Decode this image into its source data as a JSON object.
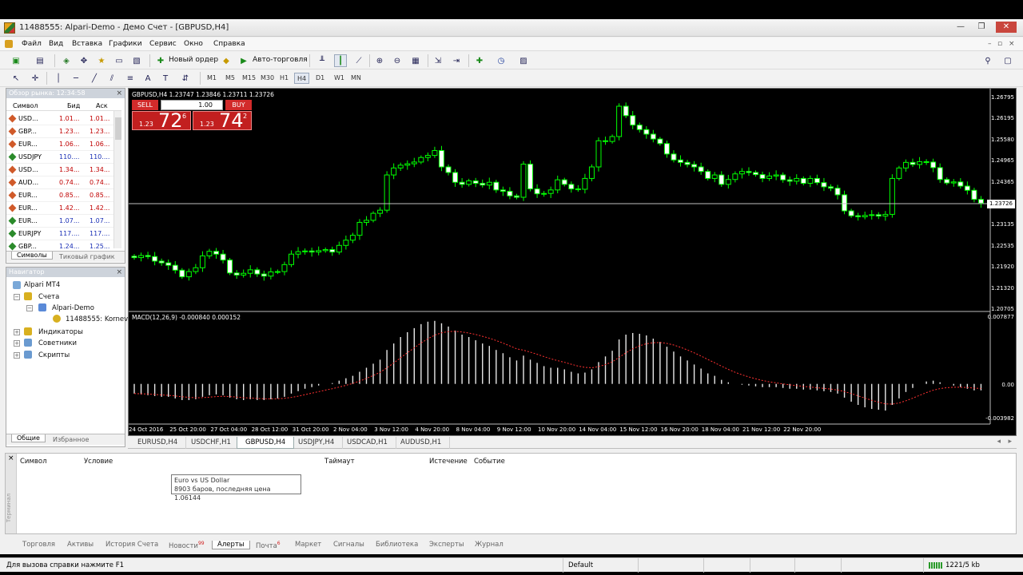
{
  "window": {
    "title": "11488555: Alpari-Demo - Демо Счет - [GBPUSD,H4]"
  },
  "menu": [
    "Файл",
    "Вид",
    "Вставка",
    "Графики",
    "Сервис",
    "Окно",
    "Справка"
  ],
  "toolbar": {
    "new_order": "Новый ордер",
    "auto_trading": "Авто-торговля"
  },
  "timeframes": [
    "M1",
    "M5",
    "M15",
    "M30",
    "H1",
    "H4",
    "D1",
    "W1",
    "MN"
  ],
  "active_timeframe": "H4",
  "market_watch": {
    "title": "Обзор рынка: 12:34:58",
    "columns": [
      "Символ",
      "Бид",
      "Аск"
    ],
    "rows": [
      {
        "symbol": "USD...",
        "bid": "1.01...",
        "ask": "1.01...",
        "color": "red"
      },
      {
        "symbol": "GBP...",
        "bid": "1.23...",
        "ask": "1.23...",
        "color": "red"
      },
      {
        "symbol": "EUR...",
        "bid": "1.06...",
        "ask": "1.06...",
        "color": "red"
      },
      {
        "symbol": "USDJPY",
        "bid": "110....",
        "ask": "110....",
        "color": "blue"
      },
      {
        "symbol": "USD...",
        "bid": "1.34...",
        "ask": "1.34...",
        "color": "red"
      },
      {
        "symbol": "AUD...",
        "bid": "0.74...",
        "ask": "0.74...",
        "color": "red"
      },
      {
        "symbol": "EUR...",
        "bid": "0.85...",
        "ask": "0.85...",
        "color": "red"
      },
      {
        "symbol": "EUR...",
        "bid": "1.42...",
        "ask": "1.42...",
        "color": "red"
      },
      {
        "symbol": "EUR...",
        "bid": "1.07...",
        "ask": "1.07...",
        "color": "blue"
      },
      {
        "symbol": "EURJPY",
        "bid": "117....",
        "ask": "117....",
        "color": "blue"
      },
      {
        "symbol": "GBP...",
        "bid": "1.24...",
        "ask": "1.25...",
        "color": "blue"
      }
    ],
    "tabs": [
      "Символы",
      "Тиковый график"
    ]
  },
  "navigator": {
    "title": "Навигатор",
    "items": [
      "Alpari MT4",
      "Счета",
      "Alpari-Demo",
      "11488555: Kornev",
      "Индикаторы",
      "Советники",
      "Скрипты"
    ],
    "tabs": [
      "Общие",
      "Избранное"
    ]
  },
  "chart": {
    "header": "GBPUSD,H4  1.23747 1.23846 1.23711 1.23726",
    "one_click": {
      "sell": "SELL",
      "buy": "BUY",
      "lot": "1.00",
      "sell_small": "1.23",
      "sell_big": "72",
      "sell_sup": "6",
      "buy_small": "1.23",
      "buy_big": "74",
      "buy_sup": "2"
    },
    "macd_label": "MACD(12,26,9) -0.000840 0.000152",
    "price_labels": [
      "1.26795",
      "1.26195",
      "1.25580",
      "1.24965",
      "1.24365",
      "1.23726",
      "1.23135",
      "1.22535",
      "1.21920",
      "1.21320",
      "1.20705"
    ],
    "current_price": "1.23726",
    "macd_labels": [
      "0.007877",
      "0.00",
      "-0.003982"
    ],
    "time_labels": [
      "24 Oct 2016",
      "25 Oct 20:00",
      "27 Oct 04:00",
      "28 Oct 12:00",
      "31 Oct 20:00",
      "2 Nov 04:00",
      "3 Nov 12:00",
      "4 Nov 20:00",
      "8 Nov 04:00",
      "9 Nov 12:00",
      "10 Nov 20:00",
      "14 Nov 04:00",
      "15 Nov 12:00",
      "16 Nov 20:00",
      "18 Nov 04:00",
      "21 Nov 12:00",
      "22 Nov 20:00"
    ]
  },
  "chart_data": {
    "type": "candlestick",
    "ylim": [
      1.20705,
      1.26795
    ],
    "close": [
      1.2218,
      1.2224,
      1.2221,
      1.2208,
      1.2203,
      1.2196,
      1.2182,
      1.2163,
      1.2178,
      1.2189,
      1.2223,
      1.2236,
      1.2228,
      1.2211,
      1.2174,
      1.2168,
      1.2173,
      1.2183,
      1.2171,
      1.2165,
      1.2177,
      1.2178,
      1.2198,
      1.2228,
      1.2235,
      1.2237,
      1.2234,
      1.2238,
      1.2241,
      1.2234,
      1.2253,
      1.2268,
      1.2282,
      1.2319,
      1.2325,
      1.2345,
      1.2354,
      1.2455,
      1.2475,
      1.2483,
      1.2487,
      1.2492,
      1.2505,
      1.2511,
      1.2525,
      1.2478,
      1.2462,
      1.2434,
      1.2428,
      1.2438,
      1.2431,
      1.2426,
      1.2434,
      1.2412,
      1.2408,
      1.2395,
      1.2391,
      1.2486,
      1.2415,
      1.2401,
      1.2402,
      1.2412,
      1.2441,
      1.2428,
      1.2415,
      1.2414,
      1.2445,
      1.2478,
      1.2553,
      1.2551,
      1.2565,
      1.2652,
      1.2625,
      1.2598,
      1.2585,
      1.2572,
      1.2558,
      1.2545,
      1.2515,
      1.2498,
      1.2491,
      1.2485,
      1.2478,
      1.2465,
      1.2445,
      1.2455,
      1.2428,
      1.2442,
      1.2458,
      1.2465,
      1.2462,
      1.2456,
      1.2445,
      1.2452,
      1.2455,
      1.2441,
      1.2437,
      1.2445,
      1.2431,
      1.2445,
      1.2433,
      1.2421,
      1.2417,
      1.2398,
      1.2352,
      1.2338,
      1.2335,
      1.2339,
      1.2341,
      1.2337,
      1.2342,
      1.2445,
      1.2475,
      1.2491,
      1.2485,
      1.2493,
      1.2492,
      1.2476,
      1.2442,
      1.2432,
      1.2435,
      1.2423,
      1.2411,
      1.2385,
      1.2374
    ],
    "macd": [
      -0.0012,
      -0.0013,
      -0.0014,
      -0.0015,
      -0.0016,
      -0.0016,
      -0.0018,
      -0.002,
      -0.002,
      -0.0019,
      -0.0016,
      -0.0014,
      -0.0013,
      -0.0014,
      -0.0017,
      -0.0019,
      -0.002,
      -0.0019,
      -0.002,
      -0.002,
      -0.0019,
      -0.0018,
      -0.0016,
      -0.0012,
      -0.0009,
      -0.0006,
      -0.0004,
      -0.0002,
      0,
      0.0001,
      0.0004,
      0.0007,
      0.001,
      0.0015,
      0.002,
      0.0025,
      0.003,
      0.0042,
      0.005,
      0.0058,
      0.0064,
      0.0069,
      0.0074,
      0.0077,
      0.0078,
      0.0075,
      0.0071,
      0.0066,
      0.0061,
      0.0058,
      0.0054,
      0.005,
      0.0047,
      0.0042,
      0.0038,
      0.0033,
      0.0029,
      0.0035,
      0.003,
      0.0026,
      0.0022,
      0.002,
      0.002,
      0.0018,
      0.0015,
      0.0013,
      0.0014,
      0.0018,
      0.0027,
      0.0034,
      0.0041,
      0.0055,
      0.0061,
      0.0063,
      0.0062,
      0.006,
      0.0056,
      0.0052,
      0.0046,
      0.004,
      0.0034,
      0.0029,
      0.0024,
      0.0019,
      0.0013,
      0.001,
      0.0005,
      0.0002,
      0,
      -0.0001,
      -0.0002,
      -0.0003,
      -0.0004,
      -0.0004,
      -0.0004,
      -0.0005,
      -0.0006,
      -0.0006,
      -0.0007,
      -0.0007,
      -0.0008,
      -0.0009,
      -0.001,
      -0.0012,
      -0.0017,
      -0.0022,
      -0.0026,
      -0.0029,
      -0.0031,
      -0.0032,
      -0.0033,
      -0.0026,
      -0.0018,
      -0.001,
      -0.0005,
      0,
      0.0003,
      0.0004,
      0.0002,
      0,
      -0.0002,
      -0.0004,
      -0.0006,
      -0.0008,
      -0.0008
    ],
    "macd_ylim": [
      -0.003982,
      0.007877
    ]
  },
  "chart_tabs": [
    "EURUSD,H4",
    "USDCHF,H1",
    "GBPUSD,H4",
    "USDJPY,H4",
    "USDCAD,H1",
    "AUDUSD,H1"
  ],
  "active_chart_tab": "GBPUSD,H4",
  "terminal": {
    "columns": [
      "Символ",
      "Условие",
      "Таймаут",
      "Истечение",
      "Событие"
    ],
    "tooltip_line1": "Euro vs US Dollar",
    "tooltip_line2": "8903 баров, последняя цена 1.06144",
    "side_label": "Терминал",
    "tabs": [
      "Торговля",
      "Активы",
      "История Счета",
      "Новости",
      "Алерты",
      "Почта",
      "Маркет",
      "Сигналы",
      "Библиотека",
      "Эксперты",
      "Журнал"
    ],
    "news_badge": "99",
    "mail_badge": "6",
    "active_tab": "Алерты"
  },
  "status": {
    "help": "Для вызова справки нажмите F1",
    "profile": "Default",
    "traffic": "1221/5 kb"
  },
  "colors": {
    "bull": "#00ff00",
    "bear": "#ffffff",
    "signal": "#ff3030",
    "sell_buy": "#d22b2b"
  }
}
